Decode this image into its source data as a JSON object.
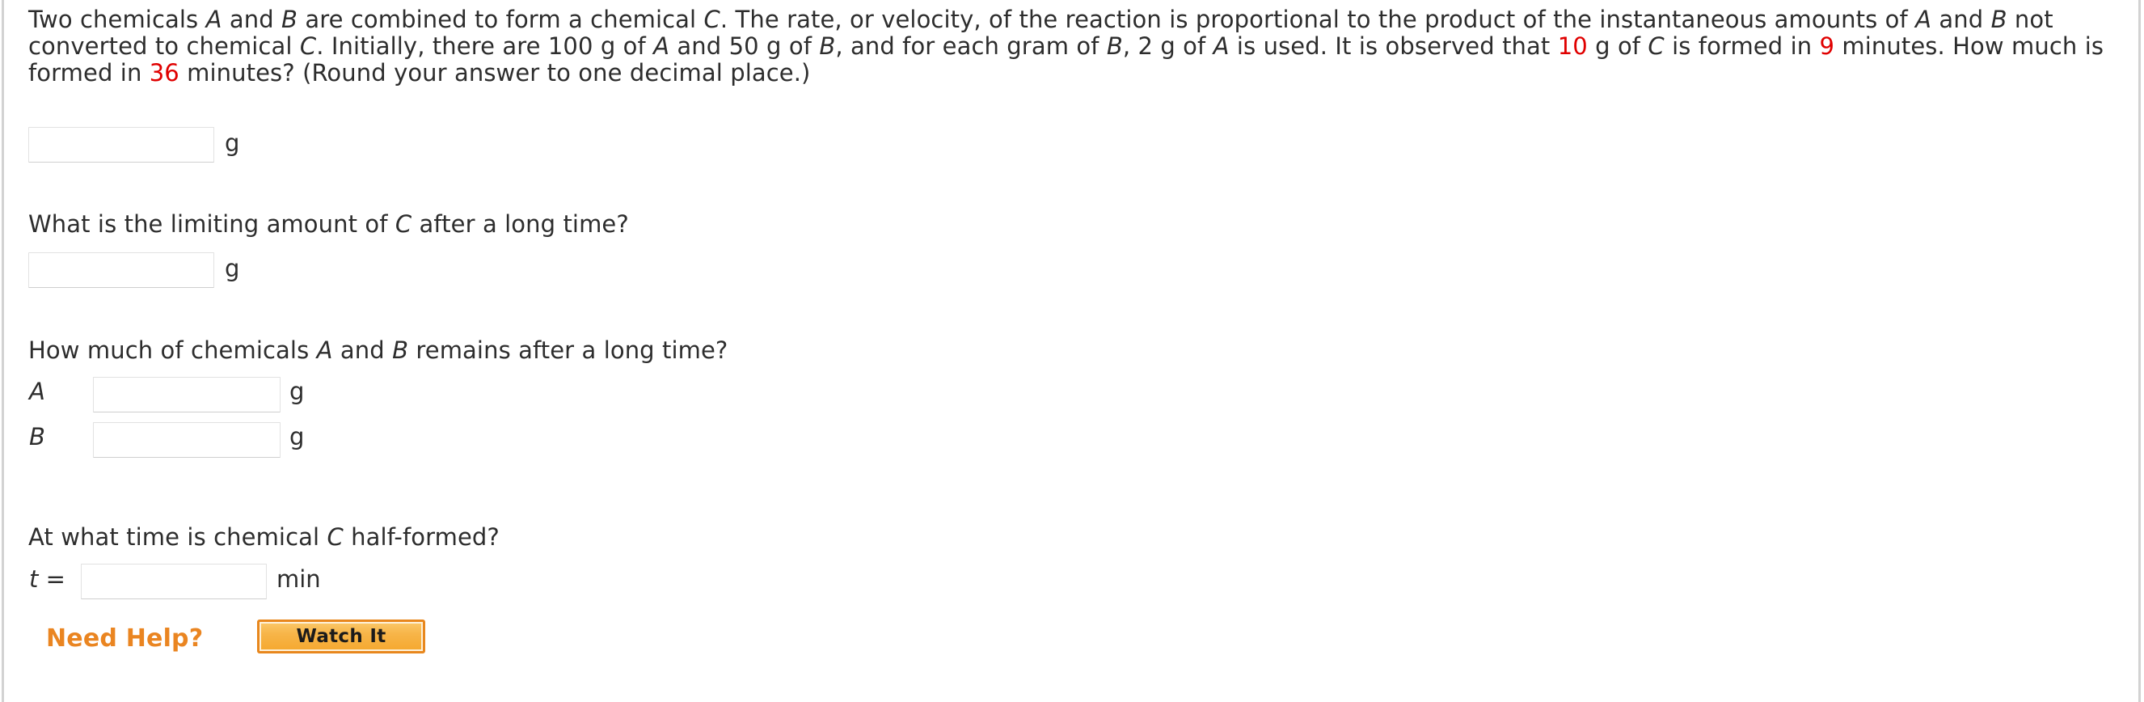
{
  "problem": {
    "paragraph": {
      "seg1": "Two chemicals ",
      "var_a1": "A",
      "seg2": " and ",
      "var_b1": "B",
      "seg3": " are combined to form a chemical ",
      "var_c1": "C",
      "seg4": ". The rate, or velocity, of the reaction is proportional to the product of the instantaneous amounts of ",
      "var_a2": "A",
      "seg5": " and ",
      "var_b2": "B",
      "seg6": " not converted to chemical ",
      "var_c2": "C",
      "seg7": ". Initially, there are 100 g of ",
      "var_a3": "A",
      "seg8": " and 50 g of ",
      "var_b3": "B",
      "seg9": ", and for each gram of ",
      "var_b4": "B",
      "seg10": ", 2 g of ",
      "var_a4": "A",
      "seg11": " is used. It is observed that ",
      "val_10": "10",
      "seg12": " g of ",
      "var_c3": "C",
      "seg13": " is formed in ",
      "val_9": "9",
      "seg14": " minutes. How much is formed in ",
      "val_36": "36",
      "seg15": " minutes? (Round your answer to one decimal place.)"
    },
    "q1": {
      "answer_value": "",
      "unit": "g"
    },
    "q2": {
      "prompt_a": "What is the limiting amount of ",
      "prompt_var": "C",
      "prompt_b": " after a long time?",
      "answer_value": "",
      "unit": "g"
    },
    "q3": {
      "prompt_a": "How much of chemicals ",
      "prompt_var1": "A",
      "prompt_b": " and ",
      "prompt_var2": "B",
      "prompt_c": " remains after a long time?",
      "rows": [
        {
          "label": "A",
          "answer_value": "",
          "unit": "g"
        },
        {
          "label": "B",
          "answer_value": "",
          "unit": "g"
        }
      ]
    },
    "q4": {
      "prompt_a": "At what time is chemical ",
      "prompt_var": "C",
      "prompt_b": " half-formed?",
      "label": "t =",
      "answer_value": "",
      "unit": "min"
    }
  },
  "help": {
    "title": "Need Help?",
    "watch_label": "Watch It"
  },
  "colors": {
    "highlight_number": "#e00000",
    "help_orange": "#ea8521",
    "button_border": "#e8871d",
    "button_fill_top": "#fbc96a",
    "button_fill_bottom": "#f5a82f",
    "text": "#2d2d2d",
    "input_border": "#e2e2e2",
    "edge_rule": "#d2d2d2"
  }
}
